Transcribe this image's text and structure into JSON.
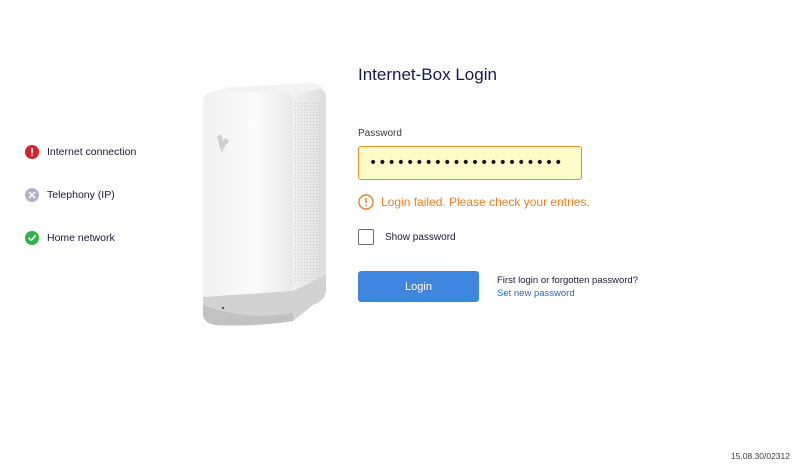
{
  "status": {
    "items": [
      {
        "label": "Internet connection",
        "state": "error",
        "color": "#d9222a"
      },
      {
        "label": "Telephony (IP)",
        "state": "inactive",
        "color": "#b4b2c8"
      },
      {
        "label": "Home network",
        "state": "ok",
        "color": "#2fb24a"
      }
    ]
  },
  "login": {
    "title": "Internet-Box Login",
    "password_label": "Password",
    "password_value": "passwordpassword12345",
    "error_message": "Login failed. Please check your entries.",
    "show_password_label": "Show password",
    "show_password_checked": false,
    "login_button": "Login",
    "help_text": "First login or forgotten password?",
    "help_link": "Set new password"
  },
  "footer": {
    "version": "15.08.30/02312"
  },
  "colors": {
    "accent": "#3f86e0",
    "error": "#e8822a",
    "input_bg": "#fdfbc7",
    "title": "#141b4d"
  }
}
